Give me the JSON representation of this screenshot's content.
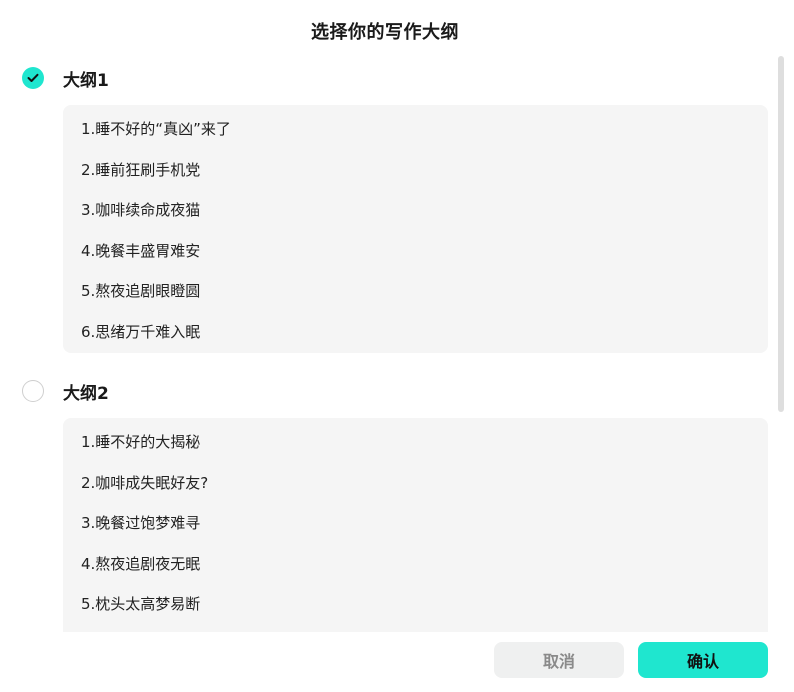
{
  "dialog": {
    "title": "选择你的写作大纲"
  },
  "outlines": [
    {
      "label": "大纲1",
      "selected": true,
      "items": [
        "1.睡不好的“真凶”来了",
        "2.睡前狂刷手机党",
        "3.咖啡续命成夜猫",
        "4.晚餐丰盛胃难安",
        "5.熬夜追剧眼瞪圆",
        "6.思绪万千难入眠"
      ]
    },
    {
      "label": "大纲2",
      "selected": false,
      "items": [
        "1.睡不好的大揭秘",
        "2.咖啡成失眠好友?",
        "3.晚餐过饱梦难寻",
        "4.熬夜追剧夜无眠",
        "5.枕头太高梦易断"
      ]
    }
  ],
  "footer": {
    "cancel_label": "取消",
    "confirm_label": "确认"
  },
  "colors": {
    "accent": "#1fe6cf",
    "card_background": "#f5f5f5",
    "cancel_background": "#eff0f0"
  },
  "icons": {
    "selected_radio": "check-icon"
  }
}
